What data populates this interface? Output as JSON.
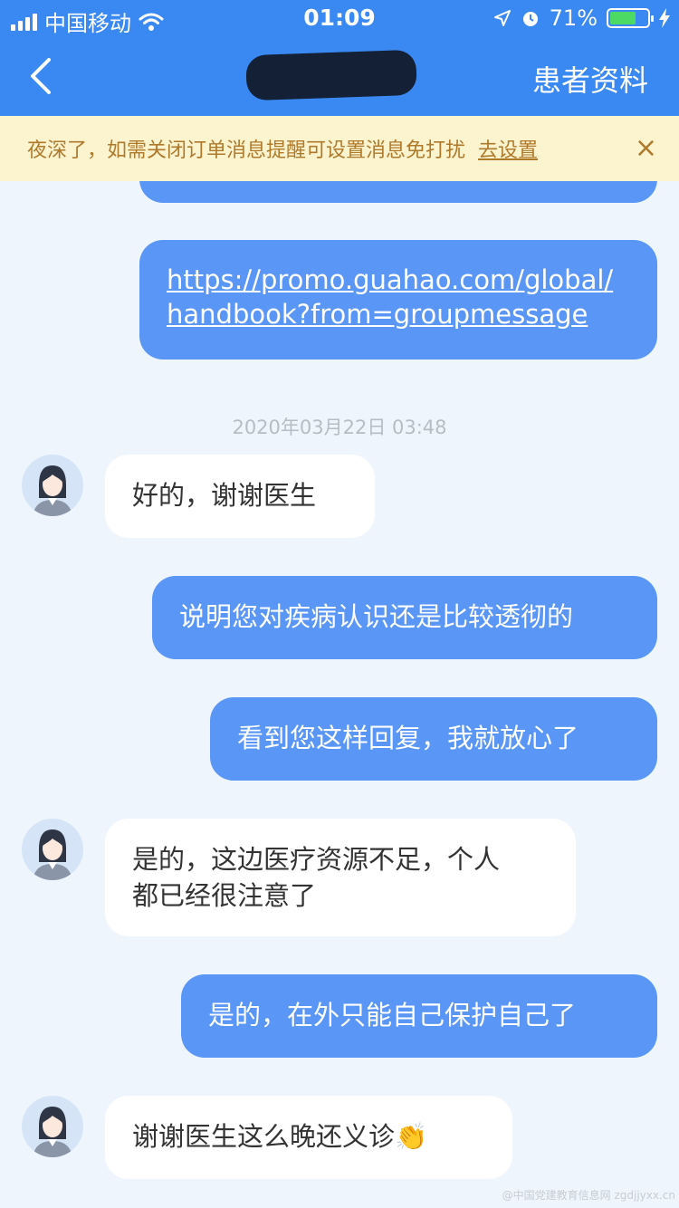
{
  "status_bar": {
    "carrier": "中国移动",
    "time": "01:09",
    "battery": "71%",
    "battery_level": 0.71
  },
  "nav": {
    "right_action": "患者资料"
  },
  "notice": {
    "text": "夜深了，如需关闭订单消息提醒可设置消息免打扰",
    "link": "去设置",
    "close": "×"
  },
  "messages": {
    "link_line1": "https://promo.guahao.com/global/",
    "link_line2": "handbook?from=groupmessage",
    "timestamp": "2020年03月22日 03:48",
    "m1": "好的，谢谢医生",
    "m2": "说明您对疾病认识还是比较透彻的",
    "m3": "看到您这样回复，我就放心了",
    "m4_line1": "是的，这边医疗资源不足，个人",
    "m4_line2": "都已经很注意了",
    "m5": "是的，在外只能自己保护自己了",
    "m6": "谢谢医生这么晚还义诊",
    "m6_emoji": "👏"
  },
  "watermark": "@中国党建教育信息网 zgdjjyxx.cn",
  "colors": {
    "header_blue": "#3a88f2",
    "my_bubble": "#5a96f5",
    "notice_bg": "#fcf3cf",
    "notice_text": "#b07a2c",
    "chat_bg": "#eef5fd"
  }
}
